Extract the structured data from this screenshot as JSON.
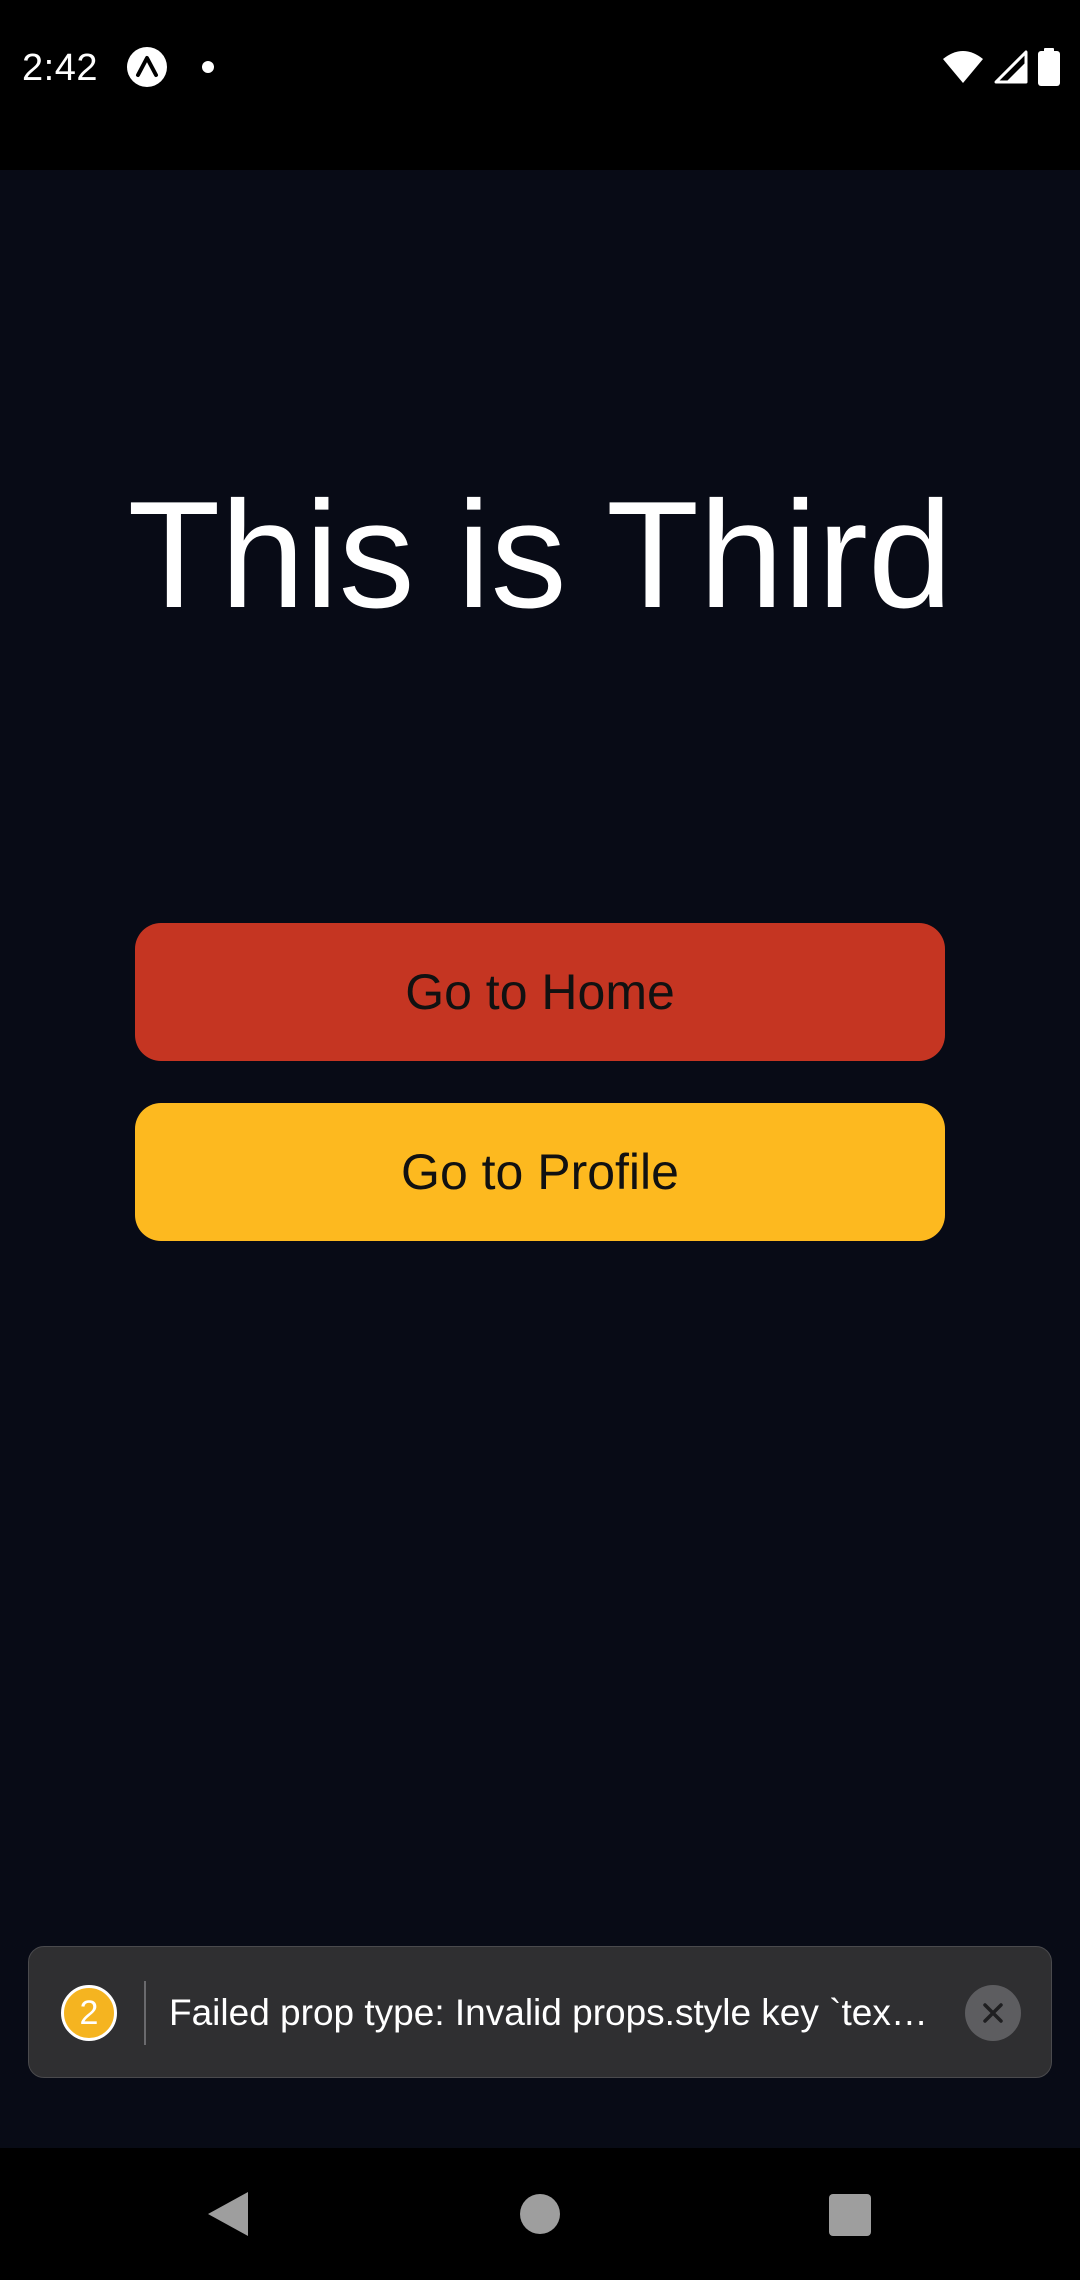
{
  "status_bar": {
    "time": "2:42",
    "icons": [
      "expo-icon",
      "notification-dot-icon",
      "wifi-icon",
      "signal-icon",
      "battery-icon"
    ]
  },
  "screen": {
    "title": "This is Third",
    "buttons": {
      "home": "Go to Home",
      "profile": "Go to Profile"
    },
    "colors": {
      "background": "#080b16",
      "home_button": "#c53522",
      "profile_button": "#fdb91f"
    }
  },
  "toast": {
    "count": "2",
    "message": "Failed prop type: Invalid props.style key `tex…"
  },
  "nav_bar": {
    "icons": [
      "back-icon",
      "home-icon",
      "recents-icon"
    ]
  }
}
